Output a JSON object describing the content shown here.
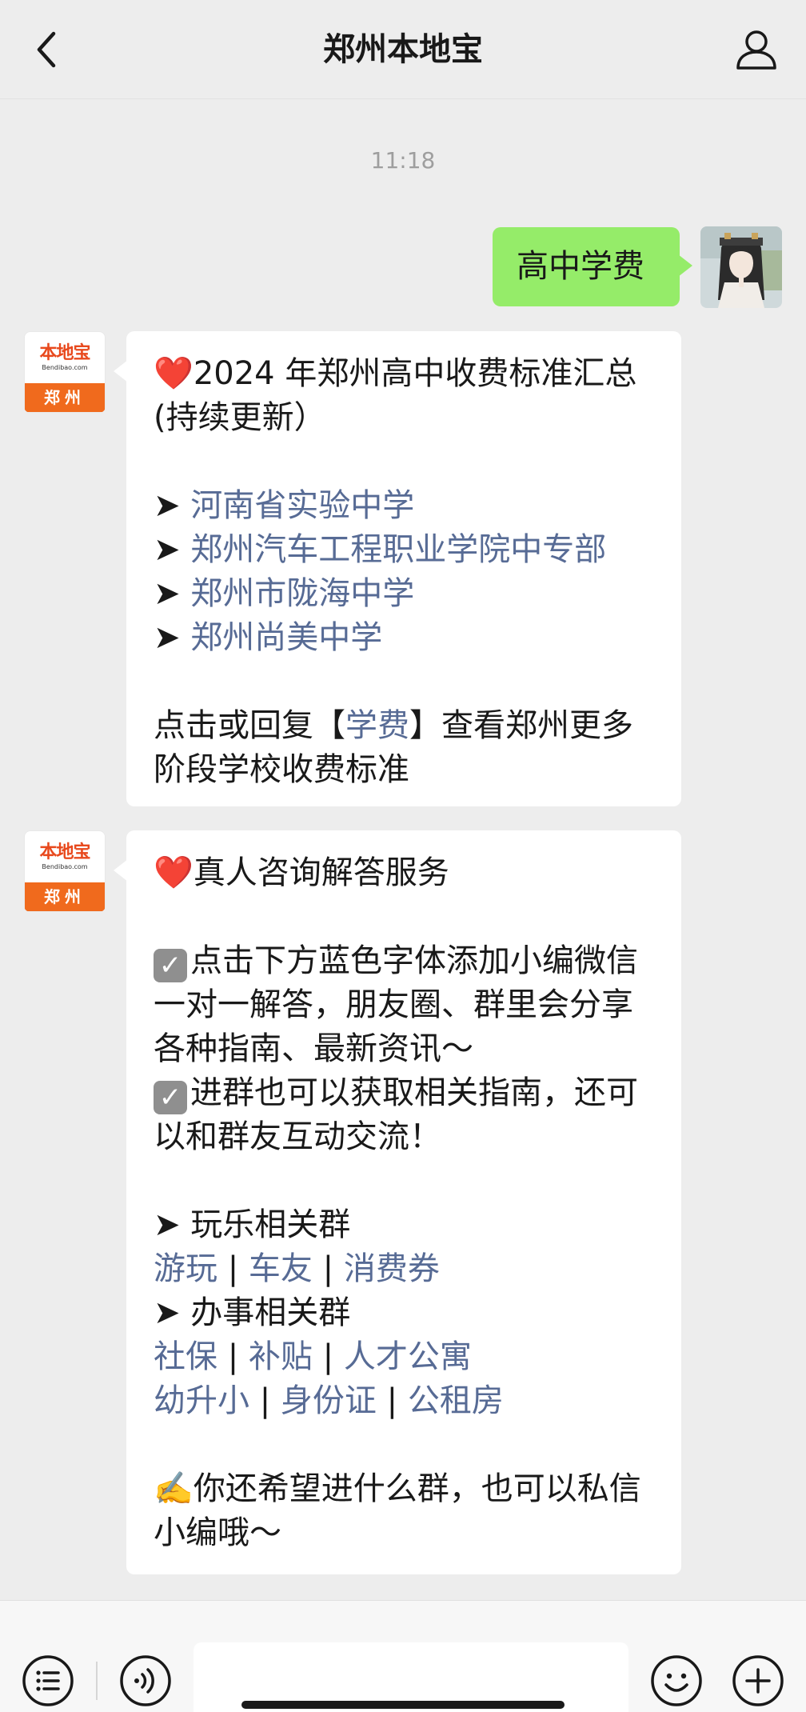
{
  "header": {
    "title": "郑州本地宝"
  },
  "chat": {
    "timestamp": "11:18",
    "user_message": "高中学费",
    "bot_logo": {
      "main": "本地宝",
      "sub": "Bendibao.com",
      "city": "郑州"
    },
    "message1": {
      "title_prefix": "❤️",
      "title": "2024 年郑州高中收费标准汇总(持续更新）",
      "bullet": "➤",
      "links": [
        "河南省实验中学",
        "郑州汽车工程职业学院中专部",
        "郑州市陇海中学",
        "郑州尚美中学"
      ],
      "footer_before": "点击或回复【",
      "footer_link": "学费",
      "footer_after": "】查看郑州更多阶段学校收费标准"
    },
    "message2": {
      "title_prefix": "❤️",
      "title": "真人咨询解答服务",
      "check_glyph": "✓",
      "para1": "点击下方蓝色字体添加小编微信一对一解答，朋友圈、群里会分享各种指南、最新资讯～",
      "para2": "进群也可以获取相关指南，还可以和群友互动交流！",
      "bullet": "➤",
      "group1_title": "玩乐相关群",
      "group1_links": [
        "游玩",
        "车友",
        "消费券"
      ],
      "group2_title": "办事相关群",
      "group2_row1": [
        "社保",
        "补贴",
        "人才公寓"
      ],
      "group2_row2": [
        "幼升小",
        "身份证",
        "公租房"
      ],
      "separator": "|",
      "closing_prefix": "✍️",
      "closing": "你还希望进什么群，也可以私信小编哦～"
    }
  },
  "input": {
    "placeholder": ""
  },
  "colors": {
    "background": "#ededed",
    "user_bubble": "#95ec69",
    "bot_bubble": "#ffffff",
    "link": "#576b95",
    "brand_orange": "#f06a1d"
  },
  "icons": [
    "back-icon",
    "profile-icon",
    "menu-list-icon",
    "voice-icon",
    "emoji-icon",
    "plus-icon"
  ]
}
